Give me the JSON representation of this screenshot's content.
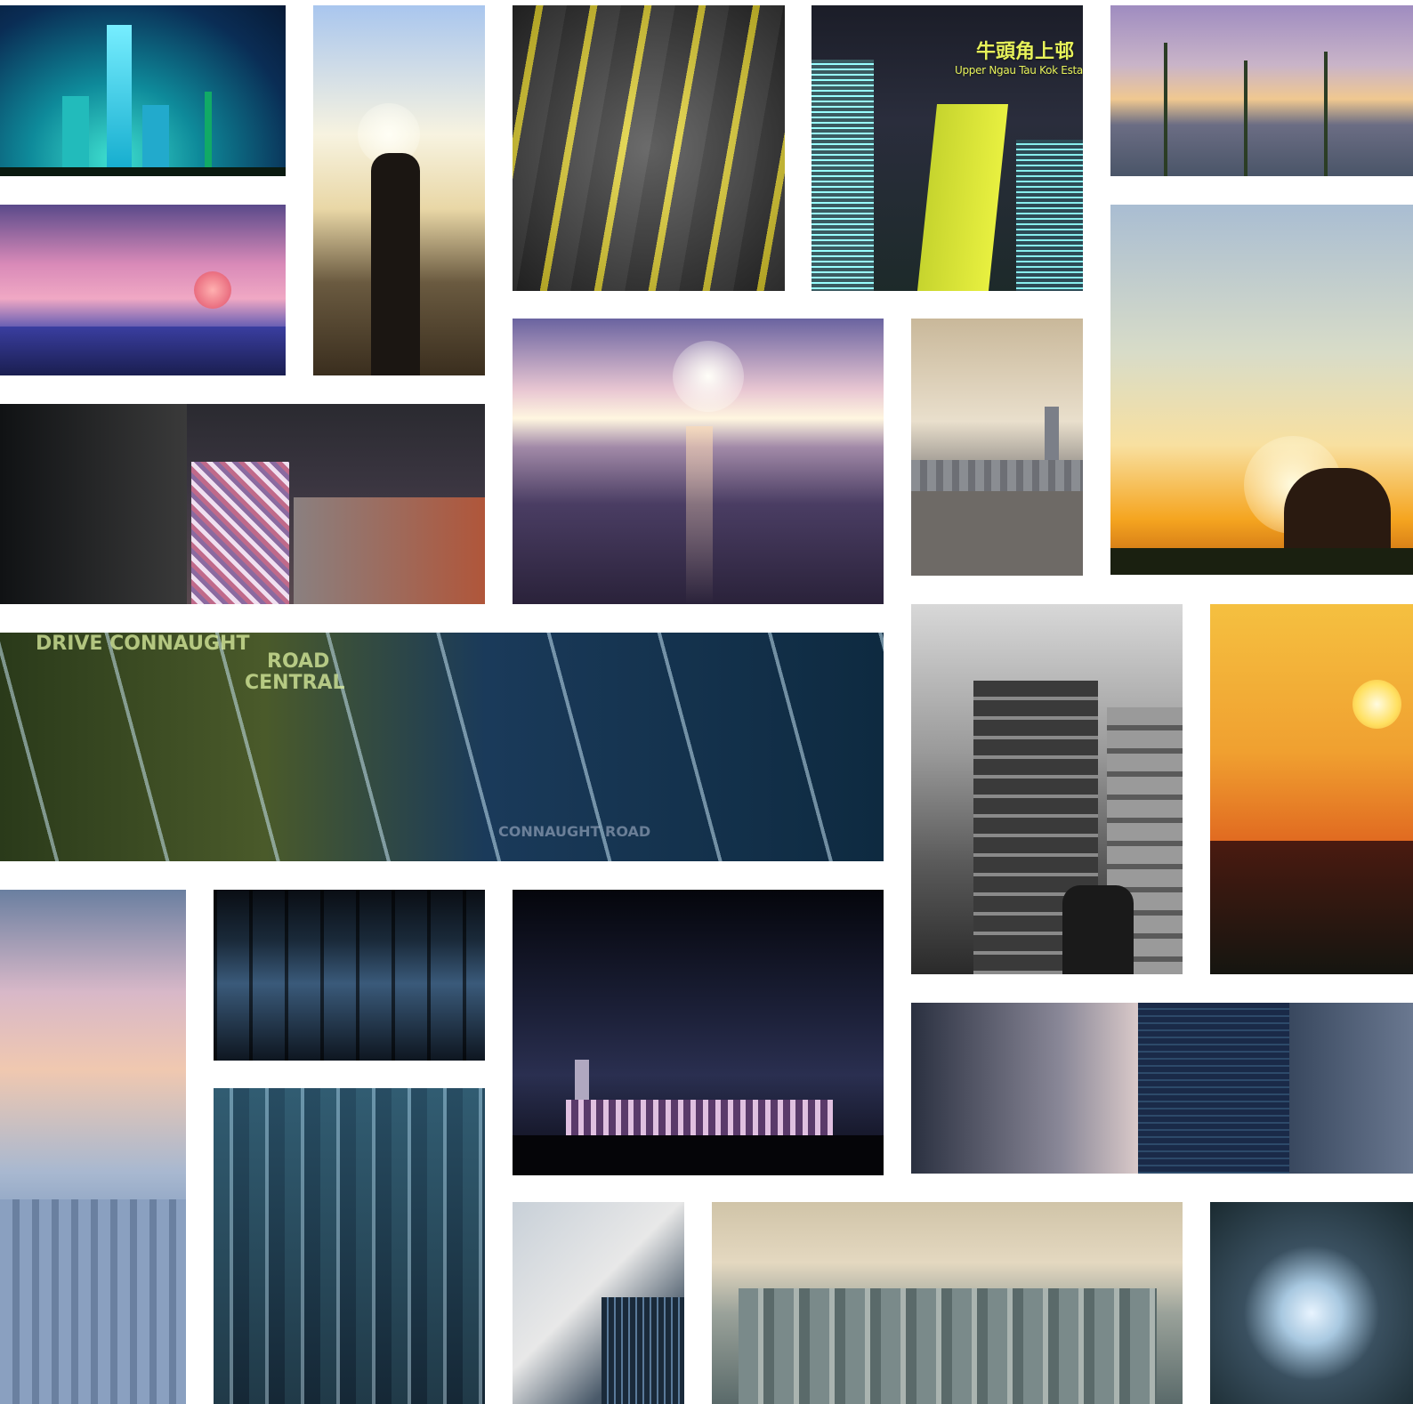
{
  "photo_1_sign": {
    "chinese": "牛頭角上邨",
    "english": "Upper Ngau Tau Kok Esta"
  },
  "photo_2_road_marking": {
    "line1": "DRIVE  CONNAUGHT",
    "line2": "ROAD",
    "line3": "CENTRAL",
    "bottom": "CONNAUGHT ROAD"
  }
}
